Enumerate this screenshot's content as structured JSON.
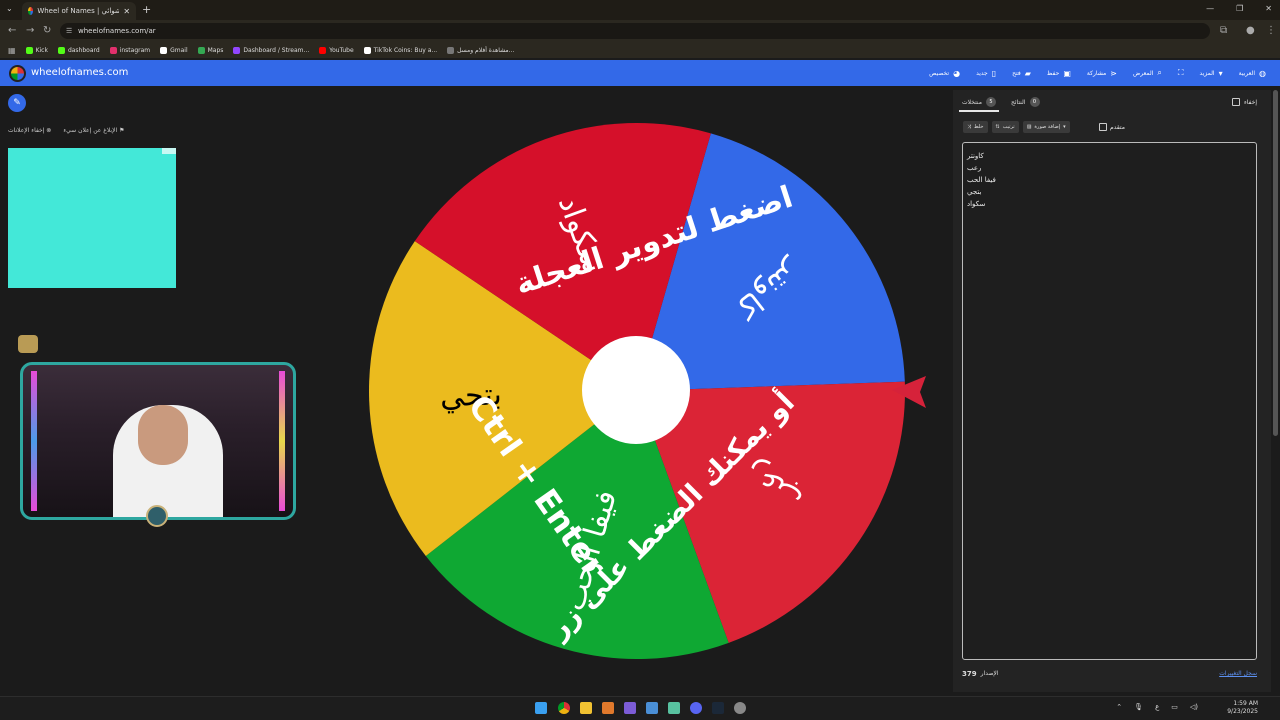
{
  "browser": {
    "tab_title": "Wheel of Names | عجلة الاسم العشوائي",
    "url": "wheelofnames.com/ar",
    "bookmarks": [
      {
        "label": "Kick",
        "color": "#53fc18"
      },
      {
        "label": "dashboard",
        "color": "#53fc18"
      },
      {
        "label": "instagram",
        "color": "#e1306c"
      },
      {
        "label": "Gmail",
        "color": "#ffffff"
      },
      {
        "label": "Maps",
        "color": "#34a853"
      },
      {
        "label": "Dashboard / Stream...",
        "color": "#9146ff"
      },
      {
        "label": "YouTube",
        "color": "#ff0000"
      },
      {
        "label": "TikTok Coins: Buy a...",
        "color": "#ffffff"
      },
      {
        "label": "مشاهدة أفلام ومسل...",
        "color": "#777777"
      }
    ]
  },
  "app": {
    "site_name": "wheelofnames.com",
    "menu": [
      {
        "label": "العربية",
        "icon": "globe-icon"
      },
      {
        "label": "المزيد",
        "icon": "caret-down-icon"
      },
      {
        "label": "",
        "icon": "fullscreen-icon"
      },
      {
        "label": "المعرض",
        "icon": "search-icon"
      },
      {
        "label": "مشاركة",
        "icon": "share-icon"
      },
      {
        "label": "حفظ",
        "icon": "save-icon"
      },
      {
        "label": "فتح",
        "icon": "folder-icon"
      },
      {
        "label": "جديد",
        "icon": "file-icon"
      },
      {
        "label": "تخصيص",
        "icon": "palette-icon"
      }
    ]
  },
  "ads": {
    "remove_ads": "إخفاء الإعلانات",
    "report_ad": "الإبلاغ عن إعلان سيء"
  },
  "wheel": {
    "slices": [
      {
        "name": "كاونتر",
        "color": "#3369e8"
      },
      {
        "name": "رعب",
        "color": "#db2436"
      },
      {
        "name": "فيفا الحب",
        "color": "#0fa833"
      },
      {
        "name": "بتجي",
        "color": "#ebbb1e"
      },
      {
        "name": "سكواد",
        "color": "#d5102a"
      }
    ],
    "instruction_1": "اضغط لتدوير العجلة",
    "instruction_2": "أو يمكنك الضغط على زر",
    "instruction_3": "Ctrl + Enter"
  },
  "panel": {
    "entries_tab": "منتخلات",
    "entries_count": "5",
    "results_tab": "النتائج",
    "results_count": "0",
    "hide_label": "إخفاء",
    "shuffle": "خلط",
    "sort": "ترتيب",
    "add_image": "إضافة صورة",
    "advanced": "متقدم",
    "entries": [
      "كاونتر",
      "رعب",
      "فيفا الحب",
      "بتجي",
      "سكواد"
    ],
    "version_label": "الإصدار",
    "version": "379",
    "changelog": "سجل التغييرات"
  },
  "taskbar": {
    "time": "1:59 AM",
    "date": "9/23/2025",
    "lang": "ع"
  }
}
